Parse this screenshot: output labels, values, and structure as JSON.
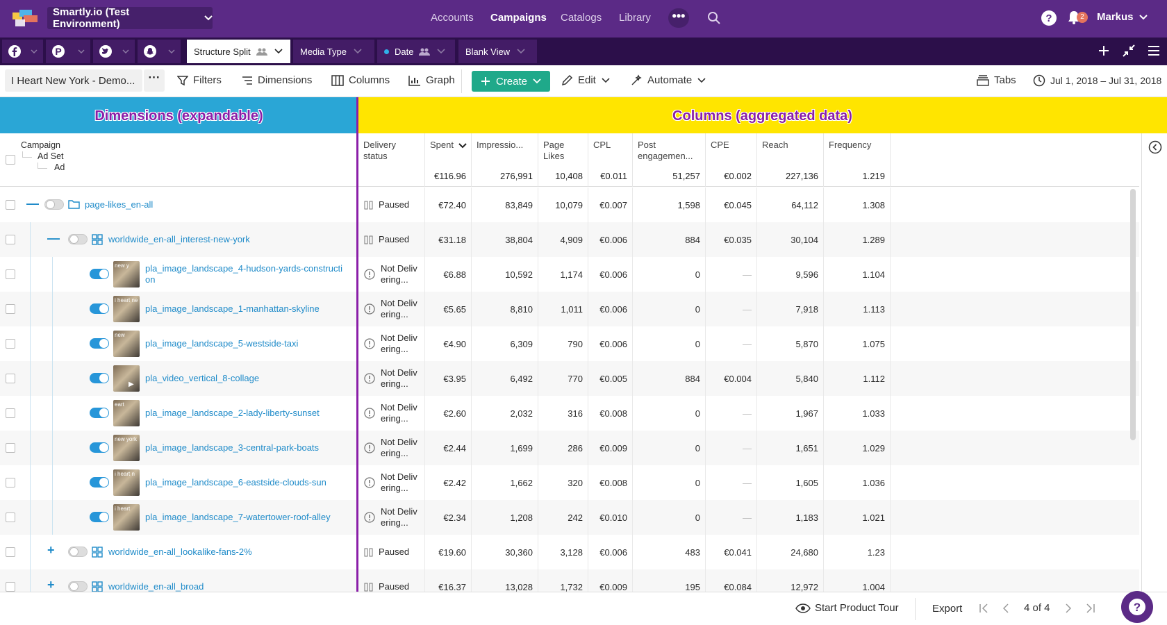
{
  "topnav": {
    "environment": "Smartly.io (Test Environment)",
    "links": [
      "Accounts",
      "Campaigns",
      "Catalogs",
      "Library"
    ],
    "active_link": "Campaigns",
    "more": "•••",
    "notifications_count": "2",
    "user": "Markus",
    "colors": {
      "bar": "#5b2a86",
      "env": "#46206b"
    }
  },
  "tabbar": {
    "platforms": [
      "facebook-icon",
      "pinterest-icon",
      "twitter-icon",
      "snapchat-icon"
    ],
    "views": [
      {
        "label": "Structure Split",
        "shared": true,
        "active": true
      },
      {
        "label": "Media Type",
        "shared": false,
        "active": false
      },
      {
        "label": "Date",
        "shared": true,
        "active": false
      },
      {
        "label": "Blank View",
        "shared": false,
        "active": false
      }
    ]
  },
  "toolbar": {
    "account": "I Heart New York - Demo...",
    "filters": "Filters",
    "dimensions": "Dimensions",
    "columns": "Columns",
    "graph": "Graph",
    "create": "Create",
    "edit": "Edit",
    "automate": "Automate",
    "tabs": "Tabs",
    "date_range": "Jul 1, 2018 – Jul 31, 2018",
    "accent": "#1fa98a"
  },
  "banners": {
    "dimensions": "Dimensions (expandable)",
    "columns": "Columns (aggregated data)"
  },
  "table": {
    "hierarchy": [
      "Campaign",
      "Ad Set",
      "Ad"
    ],
    "headers": [
      {
        "label": "Delivery status",
        "total": ""
      },
      {
        "label": "Spent",
        "total": "€116.96"
      },
      {
        "label": "Impressio...",
        "total": "276,991"
      },
      {
        "label": "Page Likes",
        "total": "10,408"
      },
      {
        "label": "CPL",
        "total": "€0.011"
      },
      {
        "label": "Post engagemen...",
        "total": "51,257"
      },
      {
        "label": "CPE",
        "total": "€0.002"
      },
      {
        "label": "Reach",
        "total": "227,136"
      },
      {
        "label": "Frequency",
        "total": "1.219"
      }
    ],
    "rows": [
      {
        "level": 0,
        "expander": "—",
        "toggle": false,
        "icon": "folder-icon",
        "name": "page-likes_en-all",
        "status": "Paused",
        "status_icon": "pause",
        "values": [
          "€72.40",
          "83,849",
          "10,079",
          "€0.007",
          "1,598",
          "€0.045",
          "64,112",
          "1.308"
        ]
      },
      {
        "level": 1,
        "expander": "—",
        "toggle": false,
        "icon": "grid-icon",
        "name": "worldwide_en-all_interest-new-york",
        "status": "Paused",
        "status_icon": "pause",
        "values": [
          "€31.18",
          "38,804",
          "4,909",
          "€0.006",
          "884",
          "€0.035",
          "30,104",
          "1.289"
        ]
      },
      {
        "level": 2,
        "toggle": true,
        "thumb": "new y",
        "name": "pla_image_landscape_4-hudson-yards-constructi\non",
        "status": "Not Deliv\nering...",
        "status_icon": "alert",
        "values": [
          "€6.88",
          "10,592",
          "1,174",
          "€0.006",
          "0",
          "—",
          "9,596",
          "1.104"
        ]
      },
      {
        "level": 2,
        "toggle": true,
        "thumb": "i heart ne",
        "name": "pla_image_landscape_1-manhattan-skyline",
        "status": "Not Deliv\nering...",
        "status_icon": "alert",
        "values": [
          "€5.65",
          "8,810",
          "1,011",
          "€0.006",
          "0",
          "—",
          "7,918",
          "1.113"
        ]
      },
      {
        "level": 2,
        "toggle": true,
        "thumb": "new",
        "name": "pla_image_landscape_5-westside-taxi",
        "status": "Not Deliv\nering...",
        "status_icon": "alert",
        "values": [
          "€4.90",
          "6,309",
          "790",
          "€0.006",
          "0",
          "—",
          "5,870",
          "1.075"
        ]
      },
      {
        "level": 2,
        "toggle": true,
        "thumb": "",
        "video": true,
        "name": "pla_video_vertical_8-collage",
        "status": "Not Deliv\nering...",
        "status_icon": "alert",
        "values": [
          "€3.95",
          "6,492",
          "770",
          "€0.005",
          "884",
          "€0.004",
          "5,840",
          "1.112"
        ]
      },
      {
        "level": 2,
        "toggle": true,
        "thumb": "eart",
        "name": "pla_image_landscape_2-lady-liberty-sunset",
        "status": "Not Deliv\nering...",
        "status_icon": "alert",
        "values": [
          "€2.60",
          "2,032",
          "316",
          "€0.008",
          "0",
          "—",
          "1,967",
          "1.033"
        ]
      },
      {
        "level": 2,
        "toggle": true,
        "thumb": "new york",
        "name": "pla_image_landscape_3-central-park-boats",
        "status": "Not Deliv\nering...",
        "status_icon": "alert",
        "values": [
          "€2.44",
          "1,699",
          "286",
          "€0.009",
          "0",
          "—",
          "1,651",
          "1.029"
        ]
      },
      {
        "level": 2,
        "toggle": true,
        "thumb": "i heart n",
        "name": "pla_image_landscape_6-eastside-clouds-sun",
        "status": "Not Deliv\nering...",
        "status_icon": "alert",
        "values": [
          "€2.42",
          "1,662",
          "320",
          "€0.008",
          "0",
          "—",
          "1,605",
          "1.036"
        ]
      },
      {
        "level": 2,
        "toggle": true,
        "thumb": "i heart",
        "name": "pla_image_landscape_7-watertower-roof-alley",
        "status": "Not Deliv\nering...",
        "status_icon": "alert",
        "values": [
          "€2.34",
          "1,208",
          "242",
          "€0.010",
          "0",
          "—",
          "1,183",
          "1.021"
        ]
      },
      {
        "level": 1,
        "expander": "+",
        "toggle": false,
        "icon": "grid-icon",
        "name": "worldwide_en-all_lookalike-fans-2%",
        "status": "Paused",
        "status_icon": "pause",
        "values": [
          "€19.60",
          "30,360",
          "3,128",
          "€0.006",
          "483",
          "€0.041",
          "24,680",
          "1.23"
        ]
      },
      {
        "level": 1,
        "expander": "+",
        "toggle": false,
        "icon": "grid-icon",
        "name": "worldwide_en-all_broad",
        "status": "Paused",
        "status_icon": "pause",
        "values": [
          "€16.37",
          "13,028",
          "1,732",
          "€0.009",
          "195",
          "€0.084",
          "12,972",
          "1.004"
        ]
      }
    ]
  },
  "footer": {
    "tour": "Start Product Tour",
    "export": "Export",
    "page": "4 of 4"
  }
}
